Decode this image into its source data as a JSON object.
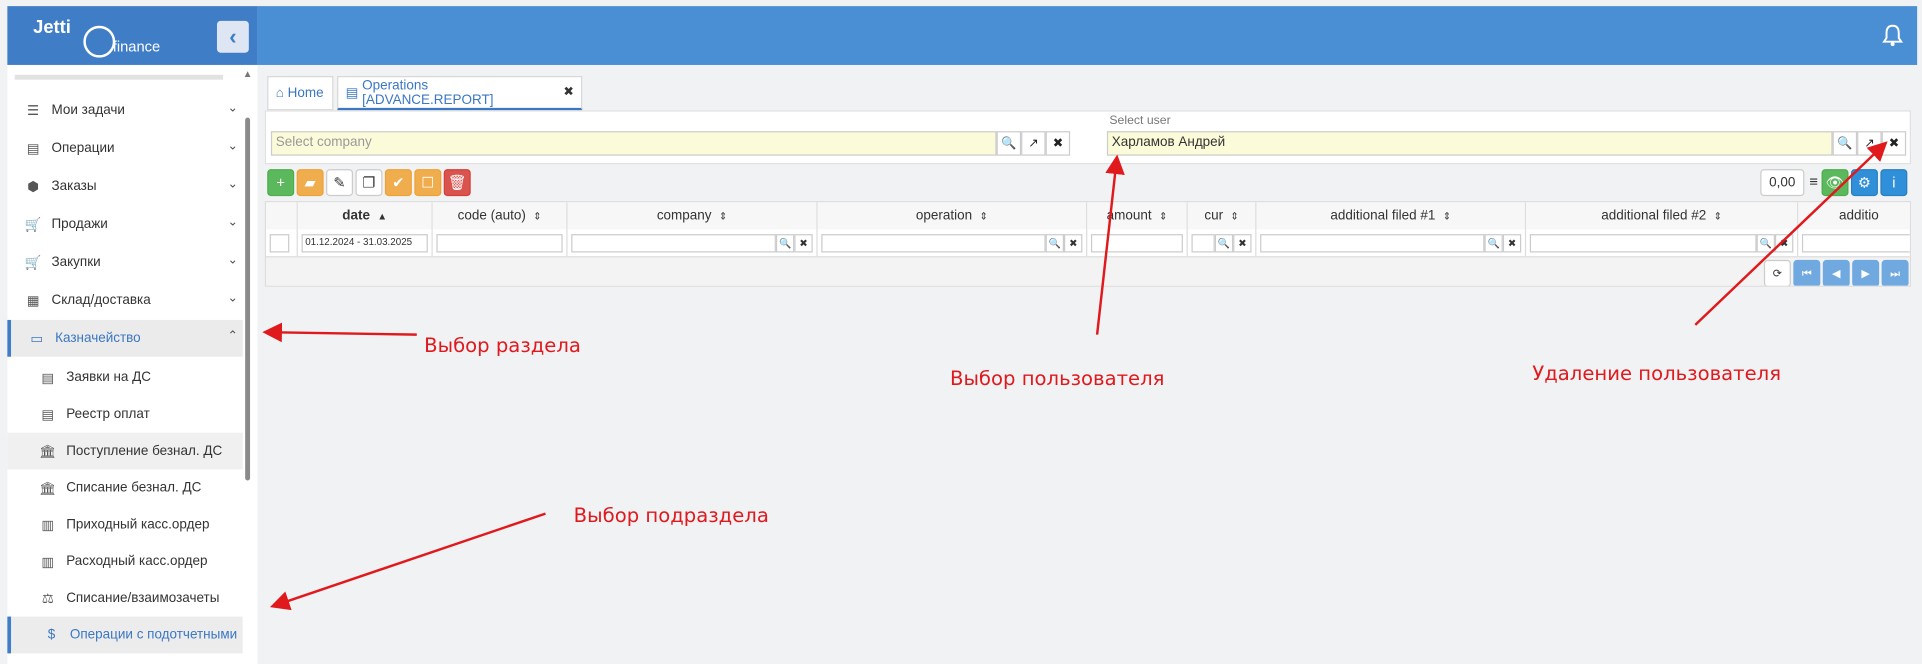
{
  "brand": {
    "name": "Jetti",
    "sub": "finance"
  },
  "sidebar": {
    "items": [
      {
        "label": "Мои задачи",
        "icon": "list-icon"
      },
      {
        "label": "Операции",
        "icon": "file-icon"
      },
      {
        "label": "Заказы",
        "icon": "cube-icon"
      },
      {
        "label": "Продажи",
        "icon": "cart-icon"
      },
      {
        "label": "Закупки",
        "icon": "cart-icon"
      },
      {
        "label": "Склад/доставка",
        "icon": "warehouse-icon"
      },
      {
        "label": "Казначейство",
        "icon": "money-icon"
      }
    ],
    "subitems": [
      {
        "label": "Заявки на ДС"
      },
      {
        "label": "Реестр оплат"
      },
      {
        "label": "Поступление безнал. ДС"
      },
      {
        "label": "Списание безнал. ДС"
      },
      {
        "label": "Приходный касс.ордер"
      },
      {
        "label": "Расходный касс.ордер"
      },
      {
        "label": "Списание/взаимозачеты"
      },
      {
        "label": "Операции с подотчетными"
      }
    ]
  },
  "tabs": {
    "home": "Home",
    "operations": "Operations [ADVANCE.REPORT]"
  },
  "filters": {
    "company_placeholder": "Select company",
    "user_label": "Select user",
    "user_value": "Харламов Андрей"
  },
  "toolbar": {
    "number": "0,00"
  },
  "grid": {
    "columns": [
      "date",
      "code (auto)",
      "company",
      "operation",
      "amount",
      "cur",
      "additional filed #1",
      "additional filed #2",
      "additio"
    ],
    "date_filter": "01.12.2024 - 31.03.2025"
  },
  "annotations": {
    "section": "Выбор раздела",
    "user": "Выбор пользователя",
    "delete_user": "Удаление пользователя",
    "subsection": "Выбор подраздела"
  },
  "colors": {
    "accent": "#3f7dc7",
    "topbar": "#4a8fd4",
    "annotation": "#e0191d",
    "lookup_bg": "#fbfbd9"
  }
}
